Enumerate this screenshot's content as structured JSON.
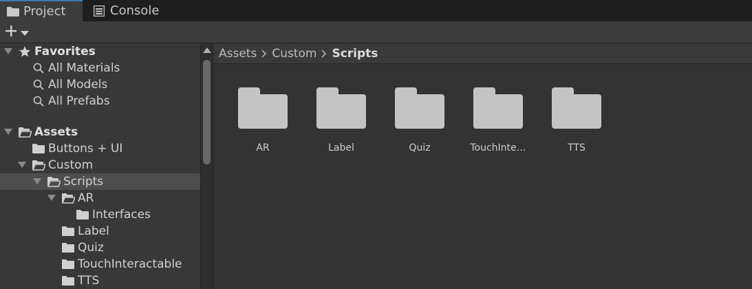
{
  "tabs": [
    {
      "label": "Project",
      "icon": "folder-icon",
      "active": true
    },
    {
      "label": "Console",
      "icon": "console-icon",
      "active": false
    }
  ],
  "toolbar": {
    "add_icon": "plus-icon",
    "add_dropdown_icon": "caret-down-icon"
  },
  "tree": {
    "favorites": {
      "label": "Favorites",
      "items": [
        "All Materials",
        "All Models",
        "All Prefabs"
      ]
    },
    "assets": {
      "label": "Assets",
      "items": [
        {
          "label": "Buttons + UI"
        },
        {
          "label": "Custom"
        },
        {
          "label": "Scripts",
          "selected": true
        },
        {
          "label": "AR"
        },
        {
          "label": "Interfaces"
        },
        {
          "label": "Label"
        },
        {
          "label": "Quiz"
        },
        {
          "label": "TouchInteractable"
        },
        {
          "label": "TTS"
        }
      ]
    }
  },
  "breadcrumb": [
    "Assets",
    "Custom",
    "Scripts"
  ],
  "folders": [
    "AR",
    "Label",
    "Quiz",
    "TouchInte…",
    "TTS"
  ],
  "colors": {
    "accent": "#3a79bb",
    "folder": "#c4c4c4",
    "selection": "#4d4d4d"
  }
}
